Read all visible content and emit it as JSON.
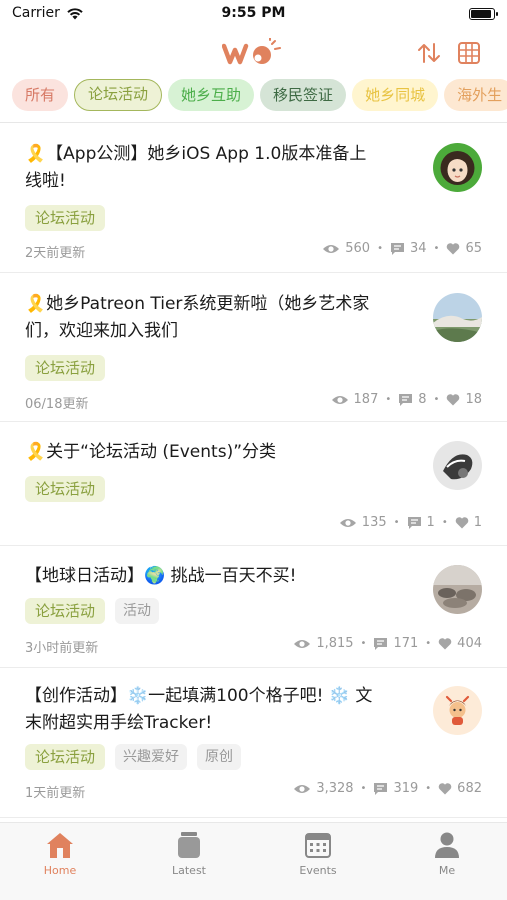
{
  "status_bar": {
    "carrier": "Carrier",
    "time": "9:55 PM",
    "battery_level": 1.0
  },
  "header": {
    "logo_icon": "wo-logo",
    "sort_icon": "sort-arrows-icon",
    "calendar_icon": "grid-calendar-icon",
    "accent_color": "#e0825e"
  },
  "chips": [
    {
      "label": "所有"
    },
    {
      "label": "论坛活动",
      "selected": true
    },
    {
      "label": "她乡互助"
    },
    {
      "label": "移民签证"
    },
    {
      "label": "她乡同城"
    },
    {
      "label": "海外生"
    }
  ],
  "posts": [
    {
      "title_line1": "🎗️【App公测】她乡iOS App 1.0版本准备上",
      "title_line2": "线啦!",
      "tags": [
        "论坛活动"
      ],
      "time": "2天前更新",
      "views": "560",
      "comments": "34",
      "likes": "65",
      "avatar": "cartoon-girl-avatar"
    },
    {
      "title_line1": "🎗️她乡Patreon Tier系统更新啦（她乡艺术家",
      "title_line2": "们，欢迎来加入我们",
      "tags": [
        "论坛活动"
      ],
      "time": "06/18更新",
      "views": "187",
      "comments": "8",
      "likes": "18",
      "avatar": "landscape-avatar"
    },
    {
      "title_line1": "🎗️关于“论坛活动 (Events)”分类",
      "title_line2": "",
      "tags": [
        "论坛活动"
      ],
      "time": "",
      "views": "135",
      "comments": "1",
      "likes": "1",
      "avatar": "bw-photo-avatar"
    },
    {
      "title_line1": "【地球日活动】🌍 挑战一百天不买!",
      "title_line2": "",
      "tags": [
        "论坛活动",
        "活动"
      ],
      "time": "3小时前更新",
      "views": "1,815",
      "comments": "171",
      "likes": "404",
      "avatar": "rocks-photo-avatar"
    },
    {
      "title_line1": "【创作活动】❄️一起填满100个格子吧! ❄️ 文",
      "title_line2": "末附超实用手绘Tracker!",
      "tags": [
        "论坛活动",
        "兴趣爱好",
        "原创"
      ],
      "time": "1天前更新",
      "views": "3,328",
      "comments": "319",
      "likes": "682",
      "avatar": "cute-character-avatar"
    }
  ],
  "tabbar": [
    {
      "label": "Home",
      "icon": "home-icon",
      "active": true
    },
    {
      "label": "Latest",
      "icon": "jar-icon",
      "active": false
    },
    {
      "label": "Events",
      "icon": "calendar-icon",
      "active": false
    },
    {
      "label": "Me",
      "icon": "person-icon",
      "active": false
    }
  ]
}
